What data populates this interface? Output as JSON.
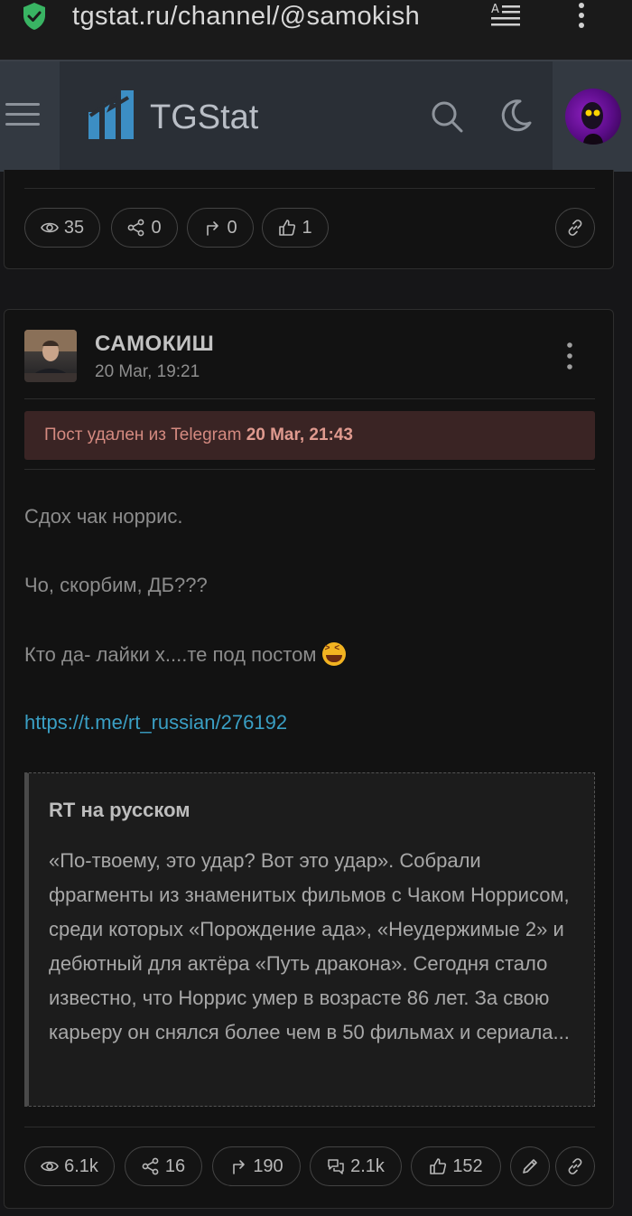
{
  "browser": {
    "url": "tgstat.ru/channel/@samokish",
    "icons": [
      "shield-check-icon",
      "reader-mode-icon",
      "kebab-menu-icon"
    ]
  },
  "header": {
    "brand": "TGStat",
    "icons": [
      "hamburger-menu-icon",
      "logo-icon",
      "search-icon",
      "moon-icon",
      "user-avatar"
    ]
  },
  "prev_post": {
    "stats": {
      "views": "35",
      "shares": "0",
      "forwards": "0",
      "reactions": "1"
    }
  },
  "post": {
    "channel": "САМОКИШ",
    "date": "20 Mar, 19:21",
    "deleted_text": "Пост удален из Telegram",
    "deleted_date": "20 Mar, 21:43",
    "lines": [
      "Сдох чак норрис.",
      "Чо, скорбим, ДБ???",
      "Кто да- лайки х....те под постом"
    ],
    "link": "https://t.me/rt_russian/276192",
    "quote": {
      "title": "RT на русском",
      "text": "«По-твоему, это удар? Вот это удар». Собрали фрагменты из знаменитых фильмов с Чаком Норрисом, среди которых «Порождение ада», «Неудержимые 2» и дебютный для актёра «Путь дракона». Сегодня стало известно, что Норрис умер в возрасте 86 лет. За свою карьеру он снялся более чем в 50 фильмах и сериала..."
    },
    "stats": {
      "views": "6.1k",
      "shares": "16",
      "forwards": "190",
      "comments": "2.1k",
      "reactions": "152"
    }
  },
  "colors": {
    "link": "#3a9fc4",
    "deleted_bg": "#3a2424",
    "deleted_text": "#d48a80",
    "header_bg": "#2a2f36"
  }
}
